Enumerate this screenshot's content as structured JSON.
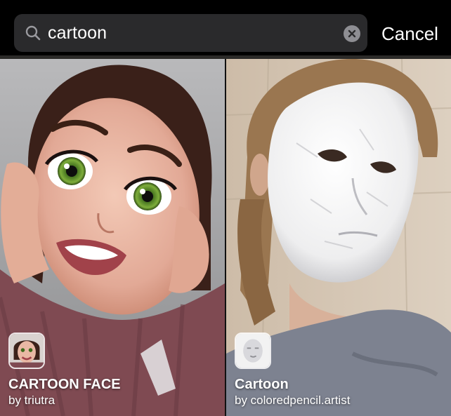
{
  "search": {
    "query": "cartoon",
    "cancel_label": "Cancel"
  },
  "results": [
    {
      "name": "CARTOON FACE",
      "author": "by triutra"
    },
    {
      "name": "Cartoon",
      "author": "by coloredpencil.artist"
    }
  ],
  "colors": {
    "search_field_bg": "#2a2a2c",
    "icon_gray": "#8e8e93",
    "text": "#ffffff"
  },
  "icons": [
    "search-icon",
    "clear-icon"
  ]
}
